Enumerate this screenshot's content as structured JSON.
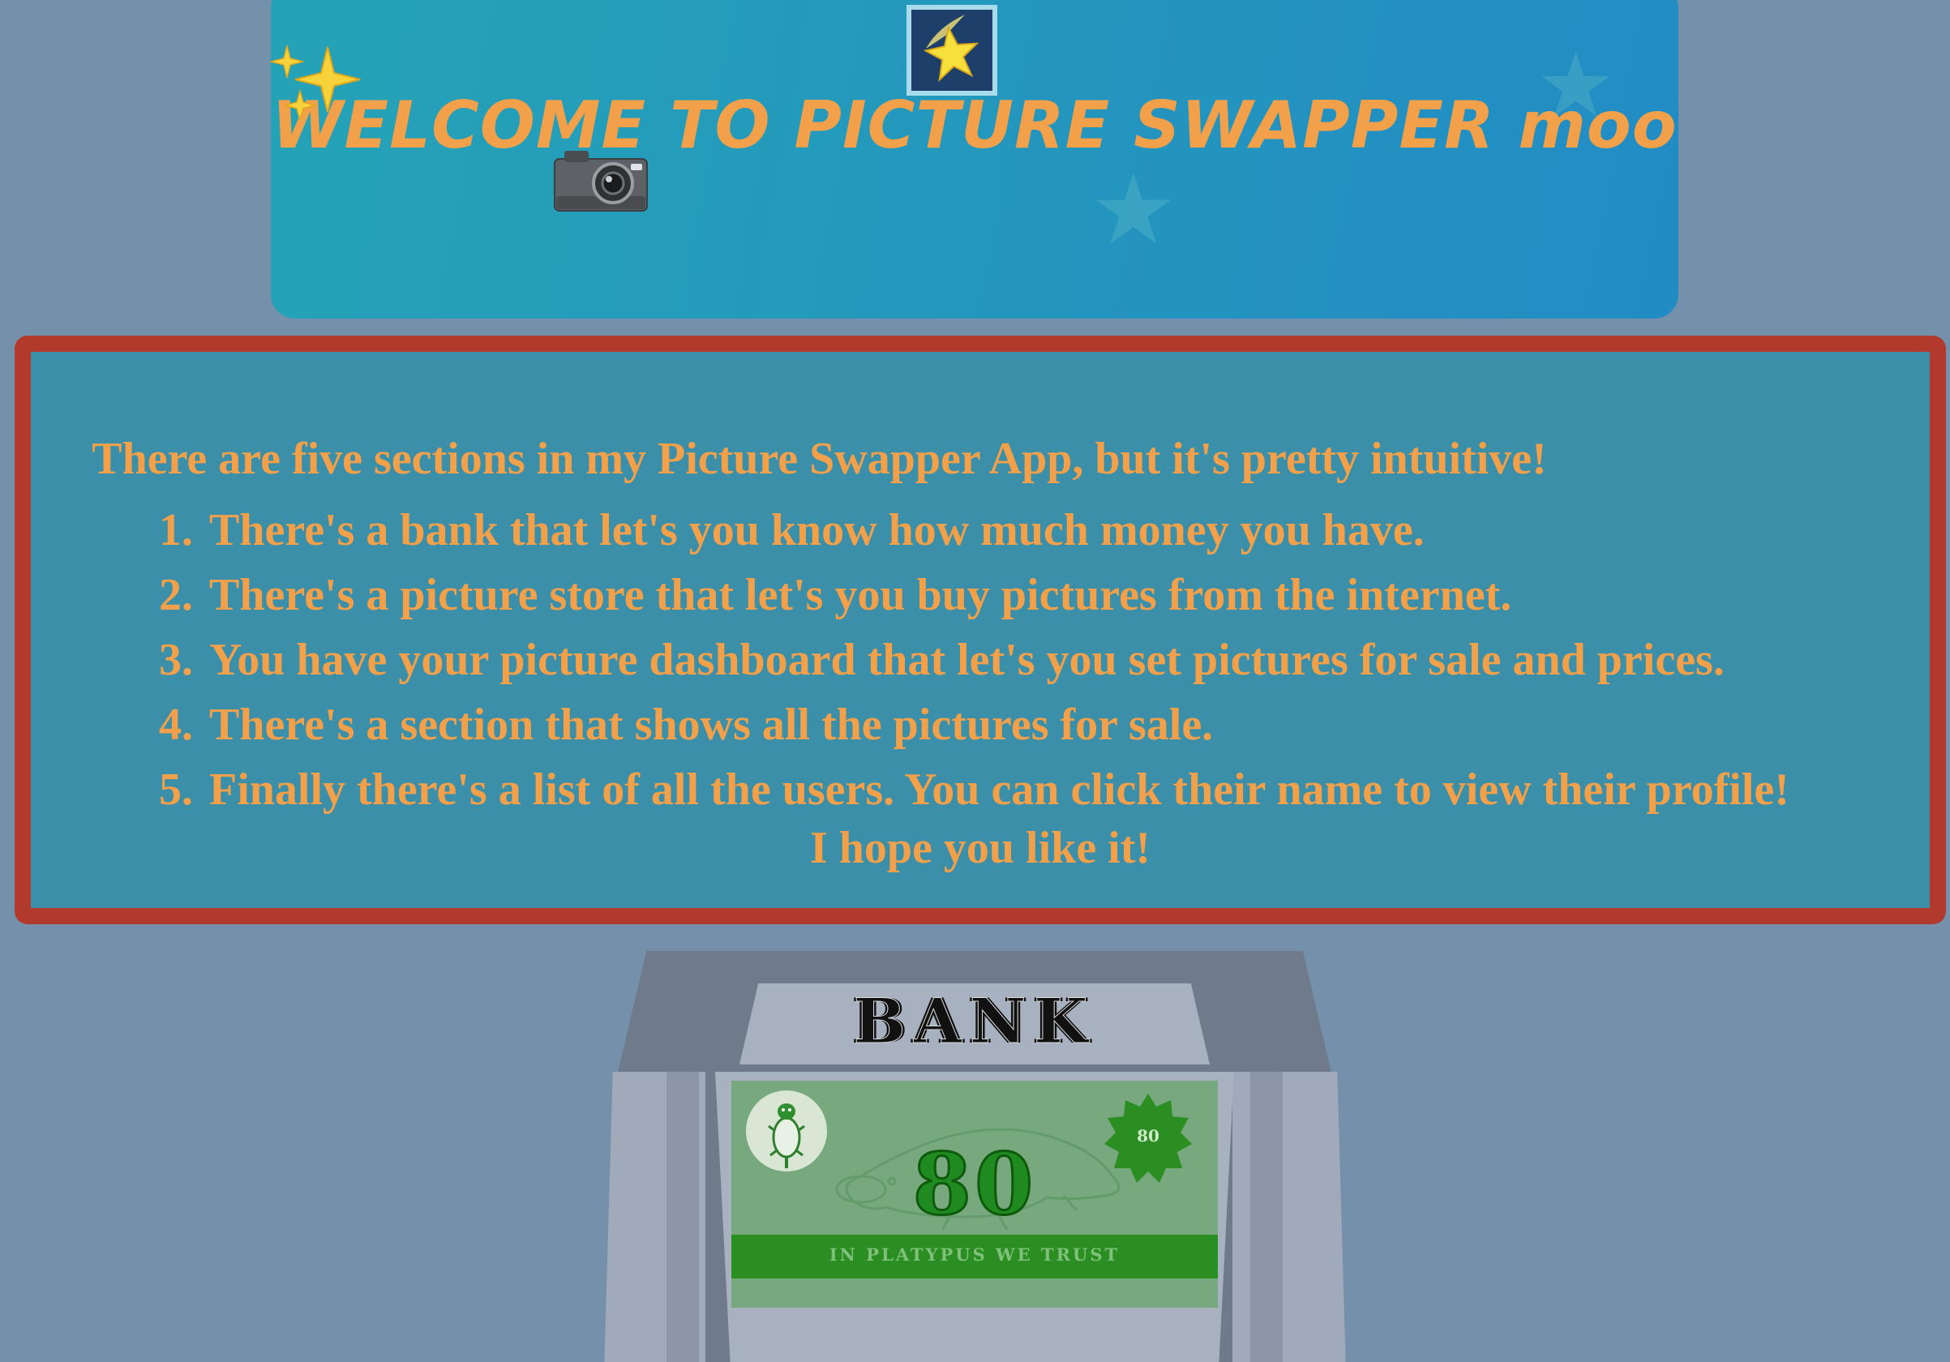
{
  "header": {
    "title": "WELCOME TO PICTURE SWAPPER moo",
    "icons": [
      "sparkles-icon",
      "camera-icon",
      "shooting-star-icon"
    ]
  },
  "instructions": {
    "intro": "There are five sections in my Picture Swapper App, but it's pretty intuitive!",
    "items": [
      {
        "num": "1.",
        "text": "There's a bank that let's you know how much money you have."
      },
      {
        "num": "2.",
        "text": "There's a picture store that let's you buy pictures from the internet."
      },
      {
        "num": "3.",
        "text": "You have your picture dashboard that let's you set pictures for sale and prices."
      },
      {
        "num": "4.",
        "text": "There's a section that shows all the pictures for sale."
      },
      {
        "num": "5.",
        "text": "Finally there's a list of all the users. You can click their name to view their profile!"
      }
    ],
    "outro": "I hope you like it!"
  },
  "bank": {
    "sign": "BANK",
    "bill": {
      "amount": "80",
      "badge_value": "80",
      "motto": "IN PLATYPUS WE TRUST"
    }
  },
  "colors": {
    "page_background": "#7590ab",
    "header_background": "#2496be",
    "title_text": "#f2a04a",
    "instructions_background": "#3c8fa8",
    "instructions_border": "#b23a2c",
    "bill_background": "#78a87d",
    "bill_green": "#2b8e23"
  }
}
